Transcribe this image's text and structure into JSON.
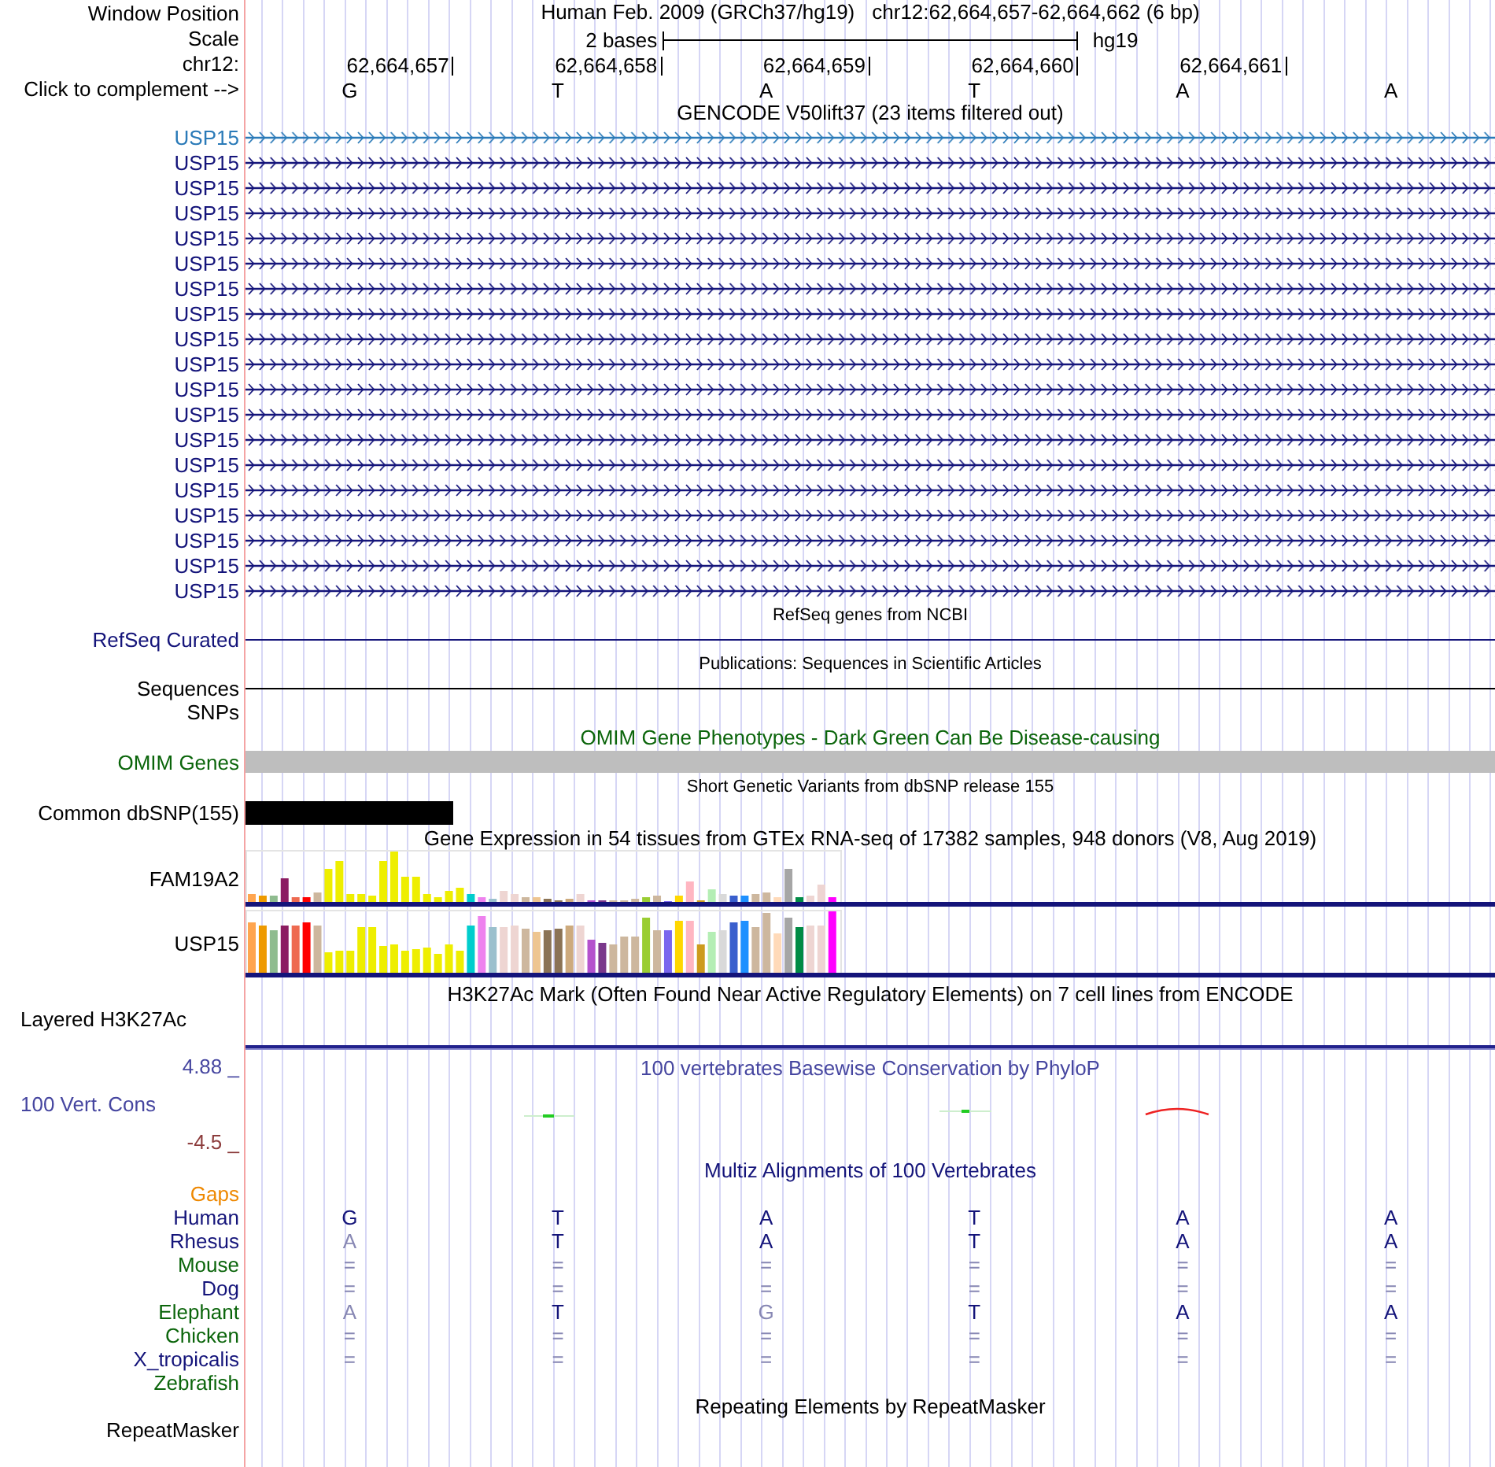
{
  "window_position": {
    "label": "Window Position",
    "assembly": "Human Feb. 2009 (GRCh37/hg19)",
    "position": "chr12:62,664,657-62,664,662 (6 bp)"
  },
  "scale": {
    "label": "Scale",
    "span": "2 bases",
    "db": "hg19"
  },
  "ruler": {
    "label": "chr12:",
    "ticks": [
      "62,664,657",
      "62,664,658",
      "62,664,659",
      "62,664,660",
      "62,664,661"
    ]
  },
  "bases": {
    "label": "Click to complement -->",
    "letters": [
      "G",
      "T",
      "A",
      "T",
      "A",
      "A"
    ]
  },
  "gencode": {
    "title": "GENCODE V50lift37 (23 items filtered out)",
    "items": [
      {
        "label": "USP15",
        "color": "#2a7ab8"
      },
      {
        "label": "USP15",
        "color": "#14147a"
      },
      {
        "label": "USP15",
        "color": "#14147a"
      },
      {
        "label": "USP15",
        "color": "#14147a"
      },
      {
        "label": "USP15",
        "color": "#14147a"
      },
      {
        "label": "USP15",
        "color": "#14147a"
      },
      {
        "label": "USP15",
        "color": "#14147a"
      },
      {
        "label": "USP15",
        "color": "#14147a"
      },
      {
        "label": "USP15",
        "color": "#14147a"
      },
      {
        "label": "USP15",
        "color": "#14147a"
      },
      {
        "label": "USP15",
        "color": "#14147a"
      },
      {
        "label": "USP15",
        "color": "#14147a"
      },
      {
        "label": "USP15",
        "color": "#14147a"
      },
      {
        "label": "USP15",
        "color": "#14147a"
      },
      {
        "label": "USP15",
        "color": "#14147a"
      },
      {
        "label": "USP15",
        "color": "#14147a"
      },
      {
        "label": "USP15",
        "color": "#14147a"
      },
      {
        "label": "USP15",
        "color": "#14147a"
      },
      {
        "label": "USP15",
        "color": "#14147a"
      }
    ]
  },
  "refseq": {
    "title": "RefSeq genes from NCBI",
    "label": "RefSeq Curated"
  },
  "publications": {
    "title": "Publications: Sequences in Scientific Articles",
    "label": "Sequences"
  },
  "snps": {
    "label": "SNPs"
  },
  "omim": {
    "title": "OMIM Gene Phenotypes - Dark Green Can Be Disease-causing",
    "label": "OMIM Genes"
  },
  "dbsnp": {
    "title": "Short Genetic Variants from dbSNP release 155",
    "label": "Common dbSNP(155)"
  },
  "gtex": {
    "title": "Gene Expression in 54 tissues from GTEx RNA-seq of 17382 samples, 948 donors (V8, Aug 2019)",
    "genes": [
      {
        "label": "FAM19A2"
      },
      {
        "label": "USP15"
      }
    ]
  },
  "h3k27ac": {
    "title": "H3K27Ac Mark (Often Found Near Active Regulatory Elements) on 7 cell lines from ENCODE",
    "label": "Layered H3K27Ac"
  },
  "conservation": {
    "title": "100 vertebrates Basewise Conservation by PhyloP",
    "label": "100 Vert. Cons",
    "max": "4.88 _",
    "min": "-4.5 _"
  },
  "multiz": {
    "title": "Multiz Alignments of 100 Vertebrates",
    "gaps_label": "Gaps",
    "species": [
      {
        "name": "Human",
        "color": "#14147a",
        "bases": [
          {
            "text": "G",
            "faded": false
          },
          {
            "text": "T",
            "faded": false
          },
          {
            "text": "A",
            "faded": false
          },
          {
            "text": "T",
            "faded": false
          },
          {
            "text": "A",
            "faded": false
          },
          {
            "text": "A",
            "faded": false
          }
        ]
      },
      {
        "name": "Rhesus",
        "color": "#14147a",
        "bases": [
          {
            "text": "A",
            "faded": true
          },
          {
            "text": "T",
            "faded": false
          },
          {
            "text": "A",
            "faded": false
          },
          {
            "text": "T",
            "faded": false
          },
          {
            "text": "A",
            "faded": false
          },
          {
            "text": "A",
            "faded": false
          }
        ]
      },
      {
        "name": "Mouse",
        "color": "#0b650b",
        "bases": [
          {
            "text": "=",
            "faded": true
          },
          {
            "text": "=",
            "faded": true
          },
          {
            "text": "=",
            "faded": true
          },
          {
            "text": "=",
            "faded": true
          },
          {
            "text": "=",
            "faded": true
          },
          {
            "text": "=",
            "faded": true
          }
        ]
      },
      {
        "name": "Dog",
        "color": "#14147a",
        "bases": [
          {
            "text": "=",
            "faded": true
          },
          {
            "text": "=",
            "faded": true
          },
          {
            "text": "=",
            "faded": true
          },
          {
            "text": "=",
            "faded": true
          },
          {
            "text": "=",
            "faded": true
          },
          {
            "text": "=",
            "faded": true
          }
        ]
      },
      {
        "name": "Elephant",
        "color": "#0b650b",
        "bases": [
          {
            "text": "A",
            "faded": true
          },
          {
            "text": "T",
            "faded": false
          },
          {
            "text": "G",
            "faded": true
          },
          {
            "text": "T",
            "faded": false
          },
          {
            "text": "A",
            "faded": false
          },
          {
            "text": "A",
            "faded": false
          }
        ]
      },
      {
        "name": "Chicken",
        "color": "#0b650b",
        "bases": [
          {
            "text": "=",
            "faded": true
          },
          {
            "text": "=",
            "faded": true
          },
          {
            "text": "=",
            "faded": true
          },
          {
            "text": "=",
            "faded": true
          },
          {
            "text": "=",
            "faded": true
          },
          {
            "text": "=",
            "faded": true
          }
        ]
      },
      {
        "name": "X_tropicalis",
        "color": "#14147a",
        "bases": [
          {
            "text": "=",
            "faded": true
          },
          {
            "text": "=",
            "faded": true
          },
          {
            "text": "=",
            "faded": true
          },
          {
            "text": "=",
            "faded": true
          },
          {
            "text": "=",
            "faded": true
          },
          {
            "text": "=",
            "faded": true
          }
        ]
      },
      {
        "name": "Zebrafish",
        "color": "#0b650b"
      }
    ]
  },
  "repeatmasker": {
    "title": "Repeating Elements by RepeatMasker",
    "label": "RepeatMasker"
  }
}
